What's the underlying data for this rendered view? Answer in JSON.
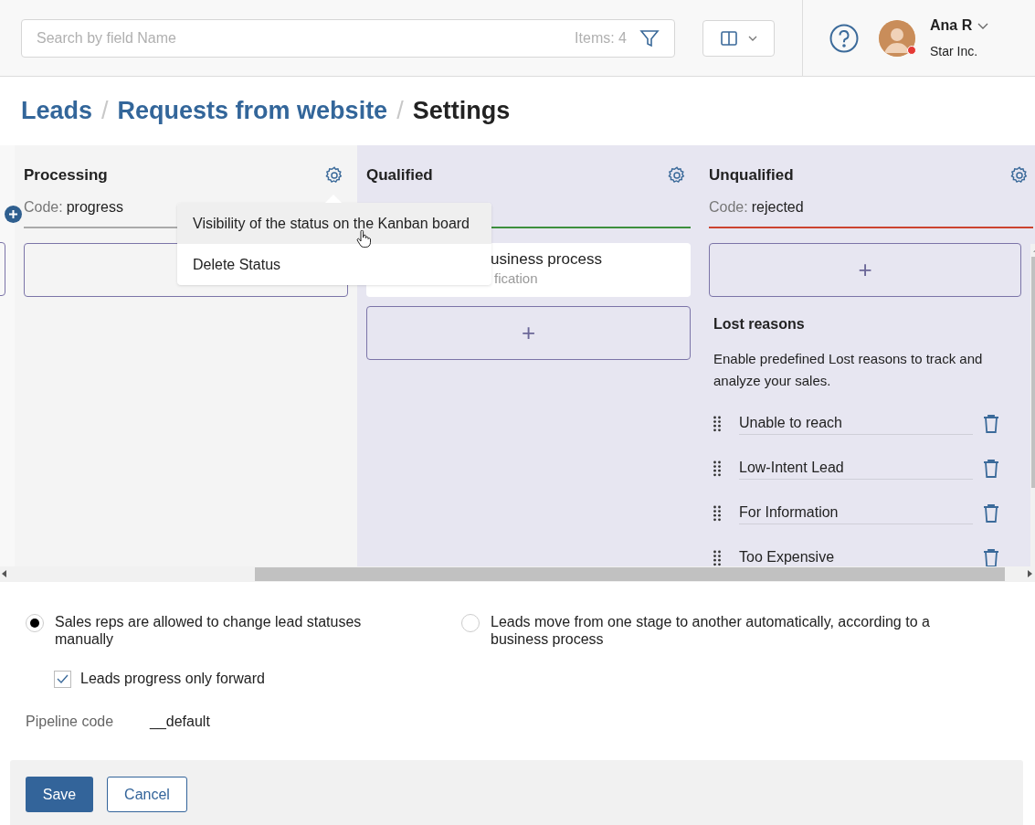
{
  "header": {
    "search": {
      "placeholder": "Search by field Name",
      "count": "Items: 4"
    },
    "user": {
      "name": "Ana R",
      "company": "Star Inc."
    }
  },
  "breadcrumb": [
    {
      "label": "Leads",
      "kind": "link"
    },
    {
      "label": "/",
      "kind": "separator"
    },
    {
      "label": "Requests from website",
      "kind": "link"
    },
    {
      "label": "/",
      "kind": "separator"
    },
    {
      "label": "Settings",
      "kind": "current"
    }
  ],
  "stages": [
    {
      "name": "Processing",
      "code_label": "Code:",
      "code": "progress",
      "color": "#aaaaaa",
      "highlighted": false,
      "cards": [
        {
          "kind": "add"
        }
      ]
    },
    {
      "name": "Qualified",
      "color": "#3d8f3d",
      "highlighted": true,
      "cards": [
        {
          "kind": "process",
          "title": "usiness process",
          "subtitle": "fication"
        },
        {
          "kind": "add",
          "symbol": "+"
        }
      ]
    },
    {
      "name": "Unqualified",
      "code_label": "Code:",
      "code": "rejected",
      "color": "#cc4430",
      "highlighted": true,
      "cards": [
        {
          "kind": "add",
          "symbol": "+"
        }
      ],
      "lost_reasons": {
        "title": "Lost reasons",
        "description": "Enable predefined Lost reasons to track and analyze your sales.",
        "items": [
          "Unable to reach",
          "Low-Intent Lead",
          "For Information",
          "Too Expensive"
        ]
      }
    }
  ],
  "context_menu": {
    "items": [
      {
        "label": "Visibility of the status on the Kanban board",
        "selected": true
      },
      {
        "label": "Delete Status",
        "selected": false
      }
    ]
  },
  "options": {
    "radios": [
      {
        "label": "Sales reps are allowed to change lead statuses manually",
        "selected": true
      },
      {
        "label": "Leads move from one stage to another automatically, according to a business process",
        "selected": false
      }
    ],
    "forward_only": {
      "label": "Leads progress only forward",
      "checked": true
    },
    "pipeline_code": {
      "label": "Pipeline code",
      "value": "__default"
    }
  },
  "buttons": [
    {
      "label": "Save",
      "kind": "primary"
    },
    {
      "label": "Cancel",
      "kind": "secondary"
    }
  ]
}
